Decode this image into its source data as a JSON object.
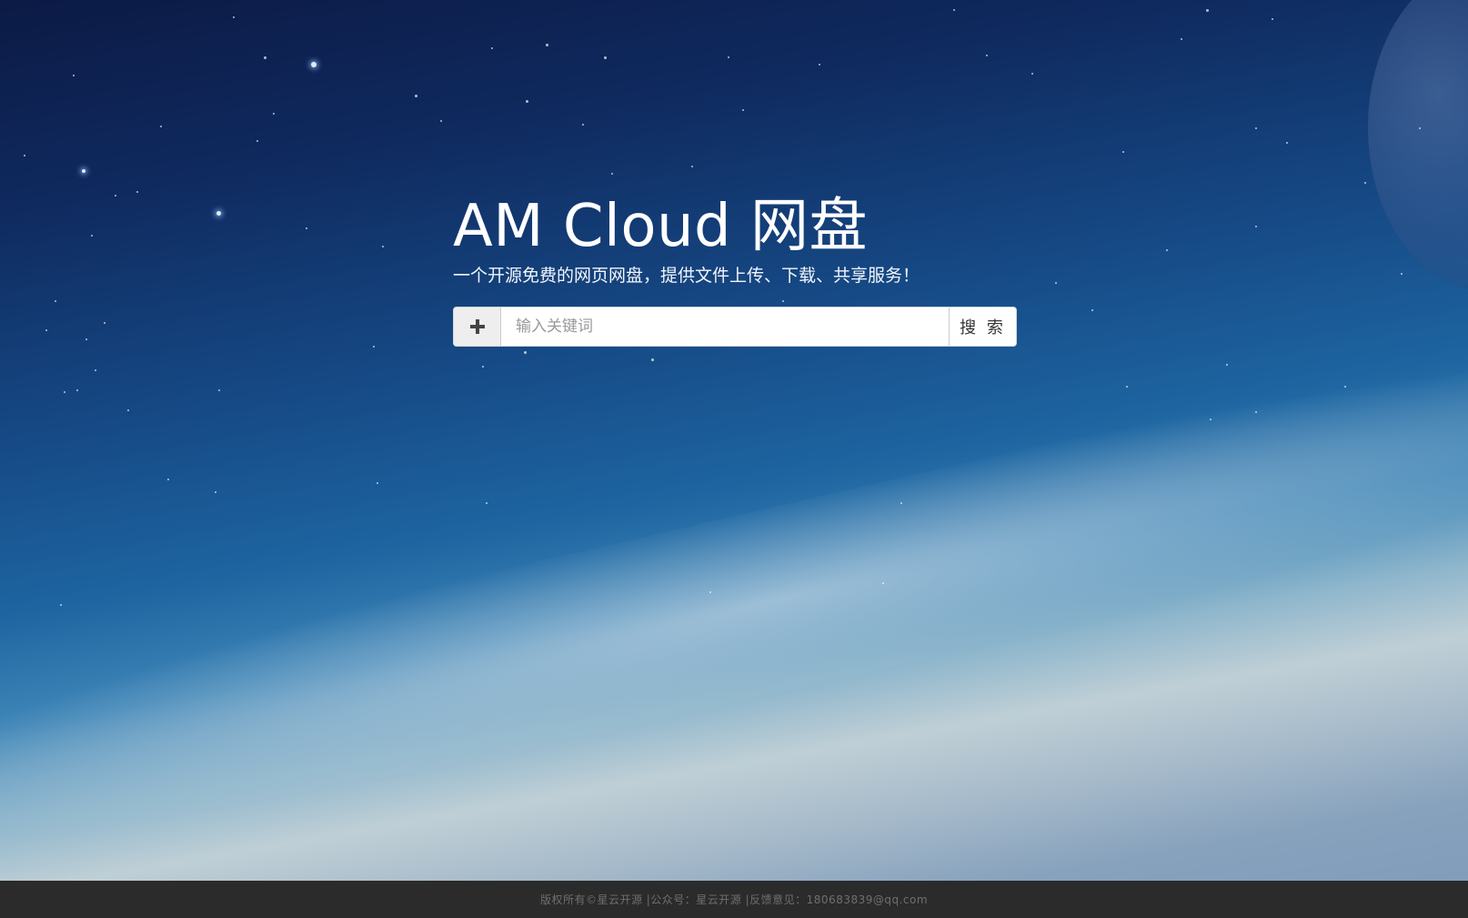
{
  "app": {
    "title": "AM Cloud 网盘",
    "subtitle": "一个开源免费的网页网盘，提供文件上传、下载、共享服务！"
  },
  "search": {
    "placeholder": "输入关键词",
    "value": "",
    "button_label": "搜 索",
    "add_icon": "plus-icon"
  },
  "footer": {
    "text": "版权所有©星云开源 |公众号：星云开源 |反馈意见：180683839@qq.com"
  },
  "colors": {
    "title": "#ffffff",
    "footer_bg": "#2b2b2b",
    "footer_text": "#6f6f6f"
  }
}
